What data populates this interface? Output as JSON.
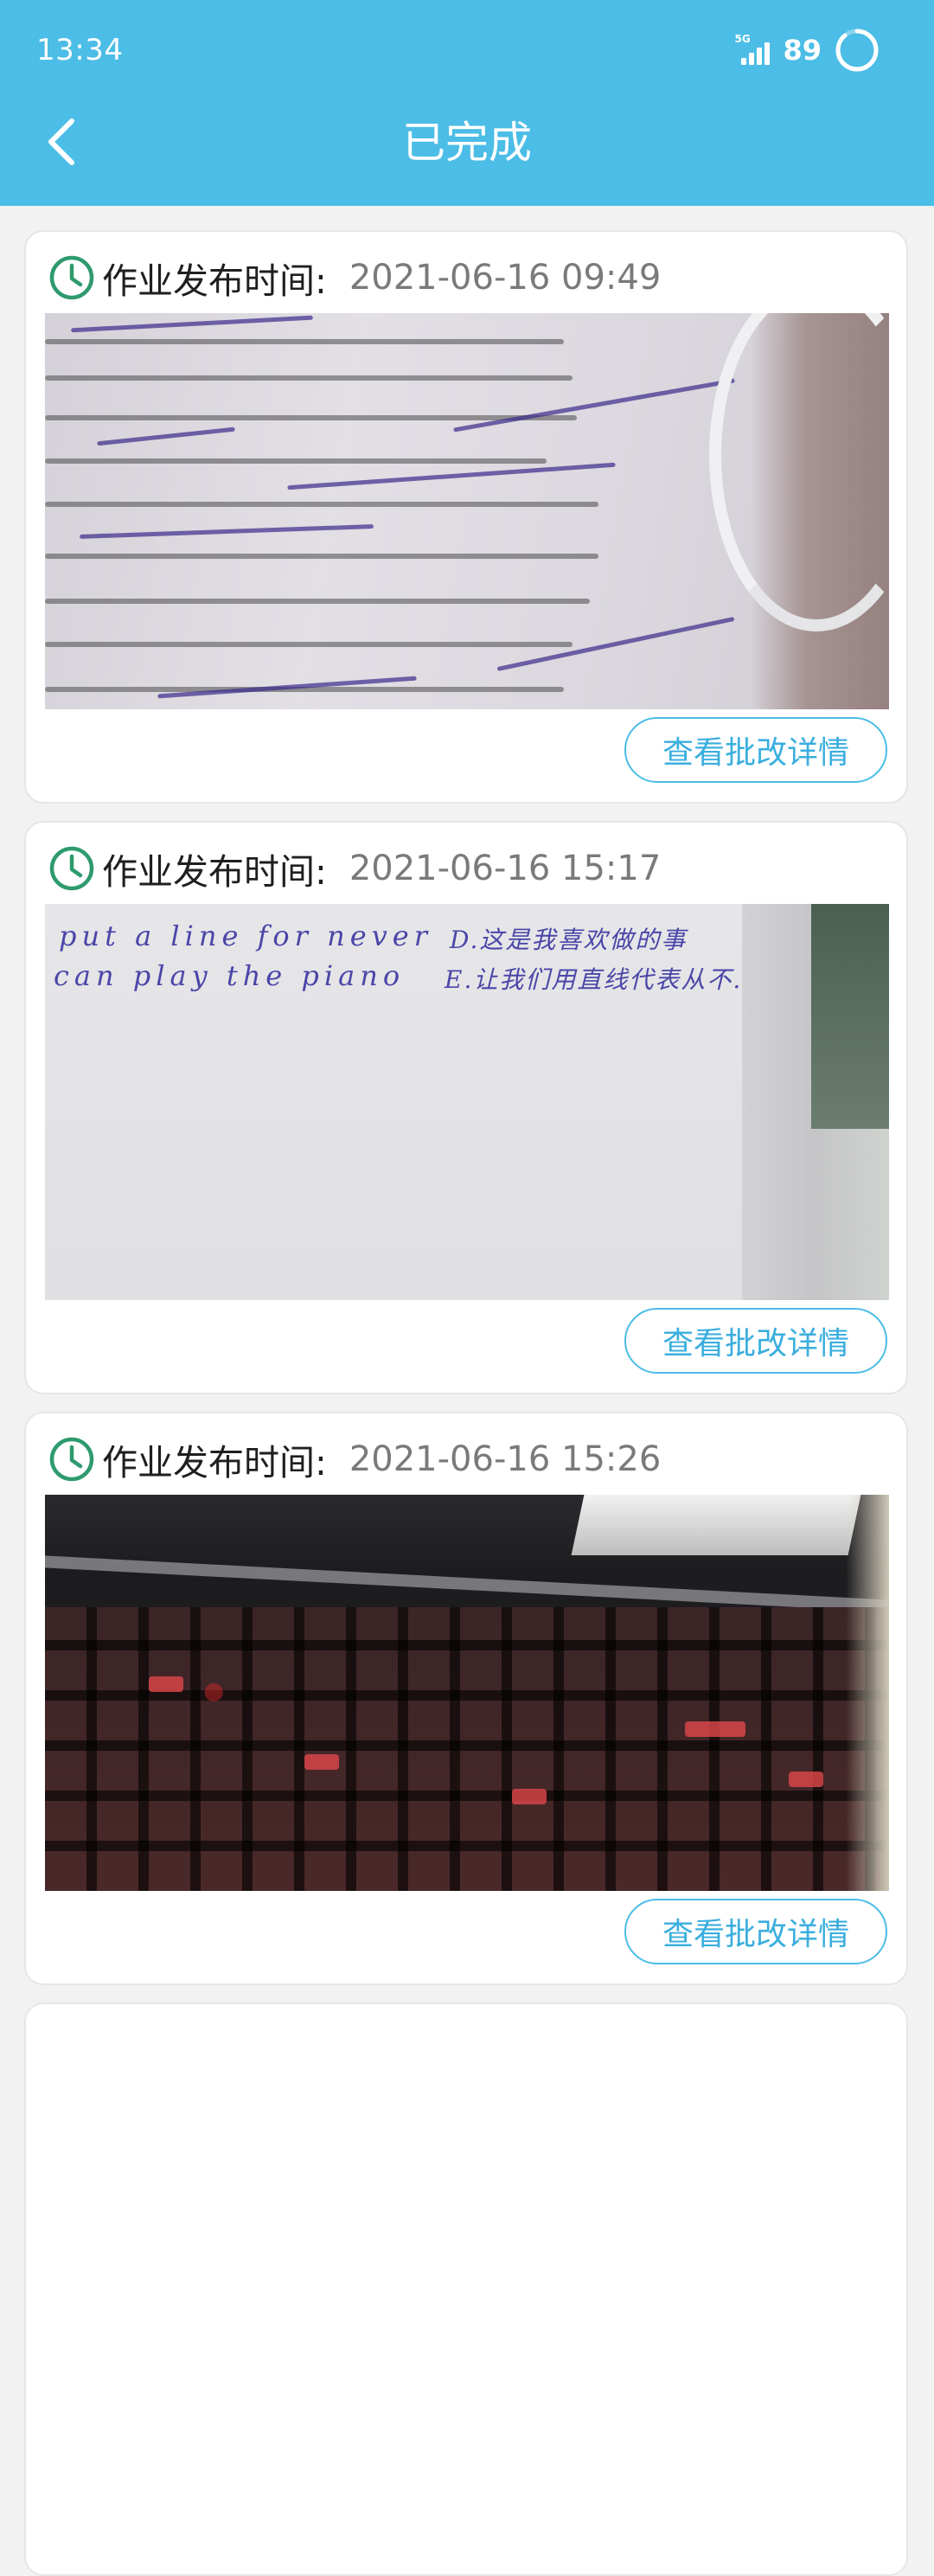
{
  "status_bar": {
    "time": "13:34",
    "network": "5G",
    "battery": "89"
  },
  "header": {
    "title": "已完成"
  },
  "colors": {
    "header_bg": "#4bbde6",
    "accent": "#3aaede",
    "clock_icon": "#2e9a6e",
    "page_bg": "#f2f2f2"
  },
  "cards": [
    {
      "time_label": "作业发布时间:",
      "time_value": "2021-06-16 09:49",
      "button_label": "查看批改详情",
      "image": "homework-photo-printed-document"
    },
    {
      "time_label": "作业发布时间:",
      "time_value": "2021-06-16 15:17",
      "button_label": "查看批改详情",
      "image": "homework-photo-handwritten-notes",
      "handwriting": {
        "line1_left": "put a line for never",
        "line2_left": "can play the piano",
        "line1_right": "D.这是我喜欢做的事",
        "line2_right": "E.让我们用直线代表从不."
      }
    },
    {
      "time_label": "作业发布时间:",
      "time_value": "2021-06-16 15:26",
      "button_label": "查看批改详情",
      "image": "homework-photo-laptop-keyboard"
    }
  ]
}
